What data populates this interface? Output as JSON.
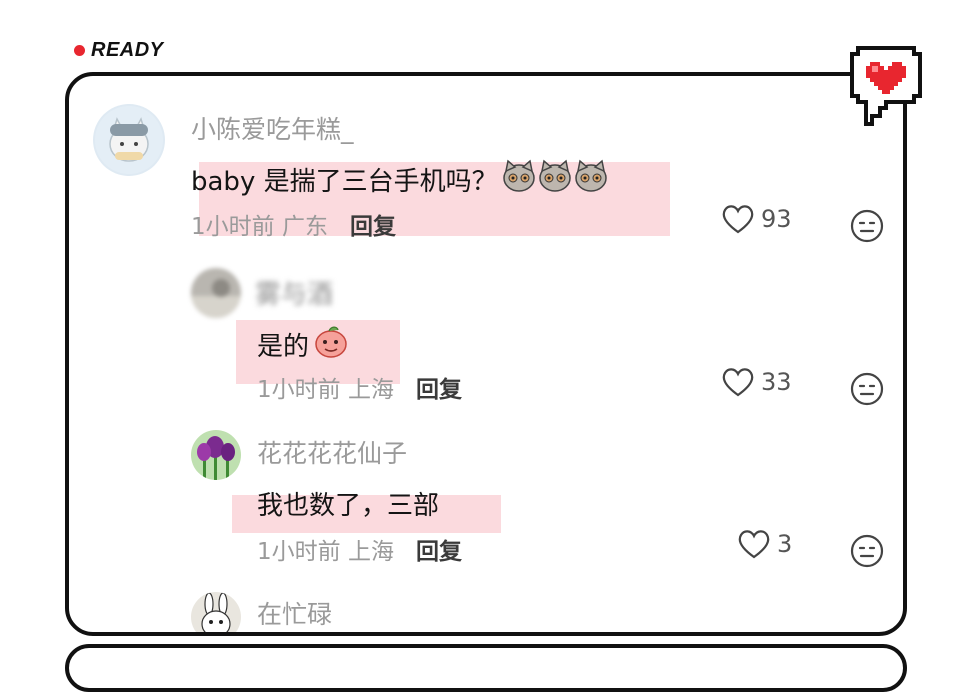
{
  "status": {
    "label": "READY"
  },
  "comments": [
    {
      "username": "小陈爱吃年糕_",
      "text": "baby 是揣了三台手机吗？",
      "time_location": "1小时前 广东",
      "reply_label": "回复",
      "likes": "93",
      "emojis": [
        "cat-face-icon",
        "cat-face-icon",
        "cat-face-icon"
      ]
    },
    {
      "username": "雾与酒",
      "text": "是的",
      "time_location": "1小时前 上海",
      "reply_label": "回复",
      "likes": "33",
      "emojis": [
        "peach-face-icon"
      ]
    },
    {
      "username": "花花花花仙子",
      "text": "我也数了，三部",
      "time_location": "1小时前 上海",
      "reply_label": "回复",
      "likes": "3"
    },
    {
      "username": "在忙碌"
    }
  ],
  "colors": {
    "highlight": "#f496a0",
    "heart": "#e8262f",
    "border": "#111111"
  }
}
